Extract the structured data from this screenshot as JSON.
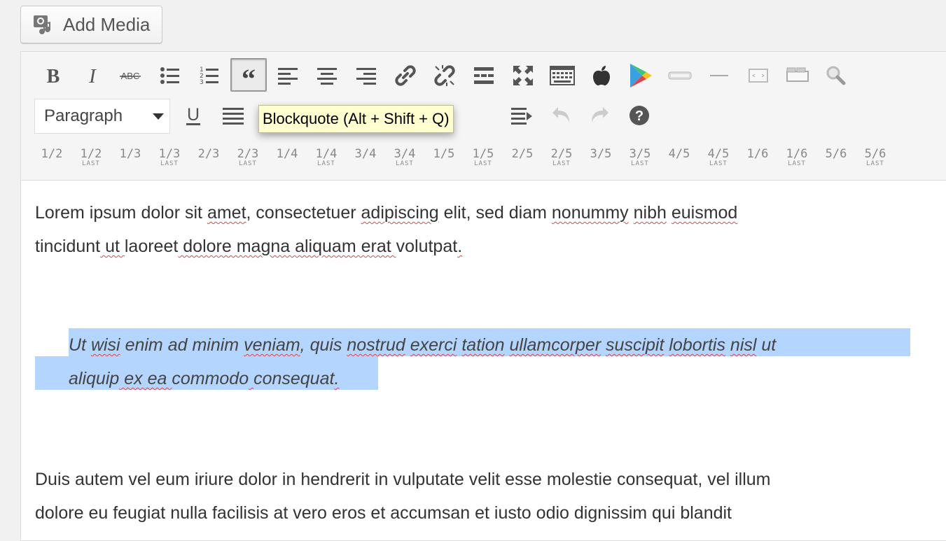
{
  "media": {
    "add_media_label": "Add Media"
  },
  "toolbar": {
    "format_select_value": "Paragraph",
    "row1_icons": [
      "bold-icon",
      "italic-icon",
      "strikethrough-icon",
      "bulleted-list-icon",
      "numbered-list-icon",
      "blockquote-icon",
      "align-left-icon",
      "align-center-icon",
      "align-right-icon",
      "insert-link-icon",
      "remove-link-icon",
      "read-more-icon",
      "fullscreen-icon",
      "toolbar-toggle-icon",
      "apple-icon",
      "google-play-icon",
      "button-shortcode-icon",
      "horizontal-line-icon",
      "box-shortcode-icon",
      "tabs-shortcode-icon",
      "search-icon"
    ],
    "row2_icons": [
      "underline-icon",
      "justify-icon",
      "indent-icon",
      "undo-icon",
      "redo-icon",
      "help-icon"
    ],
    "strikethrough_text": "ABC",
    "tooltip": "Blockquote (Alt + Shift + Q)",
    "columns": [
      {
        "frac": "1/2",
        "last": ""
      },
      {
        "frac": "1/2",
        "last": "LAST"
      },
      {
        "frac": "1/3",
        "last": ""
      },
      {
        "frac": "1/3",
        "last": "LAST"
      },
      {
        "frac": "2/3",
        "last": ""
      },
      {
        "frac": "2/3",
        "last": "LAST"
      },
      {
        "frac": "1/4",
        "last": ""
      },
      {
        "frac": "1/4",
        "last": "LAST"
      },
      {
        "frac": "3/4",
        "last": ""
      },
      {
        "frac": "3/4",
        "last": "LAST"
      },
      {
        "frac": "1/5",
        "last": ""
      },
      {
        "frac": "1/5",
        "last": "LAST"
      },
      {
        "frac": "2/5",
        "last": ""
      },
      {
        "frac": "2/5",
        "last": "LAST"
      },
      {
        "frac": "3/5",
        "last": ""
      },
      {
        "frac": "3/5",
        "last": "LAST"
      },
      {
        "frac": "4/5",
        "last": ""
      },
      {
        "frac": "4/5",
        "last": "LAST"
      },
      {
        "frac": "1/6",
        "last": ""
      },
      {
        "frac": "1/6",
        "last": "LAST"
      },
      {
        "frac": "5/6",
        "last": ""
      },
      {
        "frac": "5/6",
        "last": "LAST"
      }
    ]
  },
  "content": {
    "p1_line1": [
      "Lorem ipsum dolor sit ",
      "amet",
      ", consectetuer ",
      "adipiscing",
      " elit, sed diam ",
      "nonummy",
      " ",
      "nibh",
      " ",
      "euismod"
    ],
    "p1_line2": [
      "tincidunt",
      " ut ",
      "laoreet",
      " dolore magna aliquam erat ",
      "volutpat",
      "."
    ],
    "bq_line1": [
      "Ut ",
      "wisi",
      " enim ad minim ",
      "veniam",
      ", quis ",
      "nostrud",
      " ",
      "exerci",
      " ",
      "tation",
      " ",
      "ullamcorper",
      " ",
      "suscipit",
      " ",
      "lobortis",
      " ",
      "nisl",
      " ut"
    ],
    "bq_line2": [
      "aliquip",
      " ex ea ",
      "commodo",
      " ",
      "consequat",
      "."
    ],
    "p3_line1": "Duis autem vel eum iriure dolor in hendrerit in vulputate velit esse molestie consequat, vel illum",
    "p3_line2": "dolore eu feugiat nulla facilisis at vero eros et accumsan et iusto odio dignissim qui blandit"
  },
  "colors": {
    "selection": "#b4d5fe",
    "tooltip_bg": "#ffffcf",
    "spellcheck": "#e24444"
  }
}
